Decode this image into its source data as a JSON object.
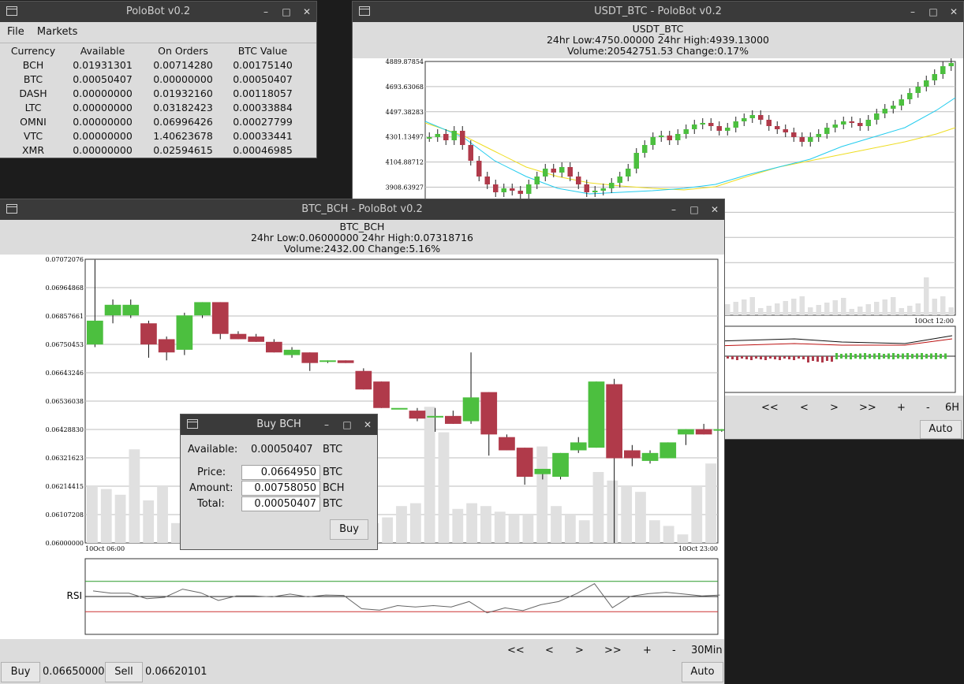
{
  "main_window": {
    "title": "PoloBot v0.2",
    "menu": [
      "File",
      "Markets"
    ],
    "balances": {
      "headers": [
        "Currency",
        "Available",
        "On Orders",
        "BTC Value"
      ],
      "rows": [
        [
          "BCH",
          "0.01931301",
          "0.00714280",
          "0.00175140"
        ],
        [
          "BTC",
          "0.00050407",
          "0.00000000",
          "0.00050407"
        ],
        [
          "DASH",
          "0.00000000",
          "0.01932160",
          "0.00118057"
        ],
        [
          "LTC",
          "0.00000000",
          "0.03182423",
          "0.00033884"
        ],
        [
          "OMNI",
          "0.00000000",
          "0.06996426",
          "0.00027799"
        ],
        [
          "VTC",
          "0.00000000",
          "1.40623678",
          "0.00033441"
        ],
        [
          "XMR",
          "0.00000000",
          "0.02594615",
          "0.00046985"
        ]
      ]
    }
  },
  "usdt_window": {
    "title": "USDT_BTC - PoloBot v0.2",
    "pair": "USDT_BTC",
    "stats_line1": "24hr Low:4750.00000  24hr High:4939.13000",
    "stats_line2": "Volume:20542751.53  Change:0.17%",
    "y_ticks": [
      "4889.87854",
      "4693.63068",
      "4497.38283",
      "4301.13497",
      "4104.88712",
      "3908.63927"
    ],
    "x_label": "10Oct 12:00",
    "nav": [
      "<<",
      "<",
      ">",
      ">>",
      "+",
      "-",
      "6H"
    ],
    "auto_label": "Auto"
  },
  "bch_window": {
    "title": "BTC_BCH - PoloBot v0.2",
    "pair": "BTC_BCH",
    "stats_line1": "24hr Low:0.06000000  24hr High:0.07318716",
    "stats_line2": "Volume:2432.00  Change:5.16%",
    "x_labels": [
      "10Oct 06:00",
      "10Oct 23:00"
    ],
    "rsi_label": "RSI",
    "nav": [
      "<<",
      "<",
      ">",
      ">>",
      "+",
      "-",
      "30Min"
    ],
    "buy_label": "Buy",
    "buy_price": "0.06650000",
    "sell_label": "Sell",
    "sell_price": "0.06620101",
    "auto_label": "Auto"
  },
  "buy_dialog": {
    "title": "Buy BCH",
    "available_label": "Available:",
    "available_value": "0.00050407",
    "available_unit": "BTC",
    "price_label": "Price:",
    "price_value": "0.0664950",
    "price_unit": "BTC",
    "amount_label": "Amount:",
    "amount_value": "0.00758050",
    "amount_unit": "BCH",
    "total_label": "Total:",
    "total_value": "0.00050407",
    "total_unit": "BTC",
    "buy_button": "Buy"
  },
  "colors": {
    "up": "#4cbf3f",
    "down": "#b03a4a",
    "volume": "#e0e0e0",
    "ma_fast": "#22ccee",
    "ma_slow": "#eedd22"
  },
  "chart_data": [
    {
      "type": "candlestick",
      "pair": "BTC_BCH",
      "interval": "30Min",
      "ylim": [
        0.06,
        0.07072076
      ],
      "y_ticks": [
        "0.07072076",
        "0.06964868",
        "0.06857661",
        "0.06750453",
        "0.06643246",
        "0.06536038",
        "0.06428830",
        "0.06321623",
        "0.06214415",
        "0.06107208",
        "0.06000000"
      ],
      "candles": [
        [
          0.0675,
          0.0684,
          0.0674,
          0.0707
        ],
        [
          0.0686,
          0.069,
          0.0683,
          0.0692
        ],
        [
          0.0686,
          0.069,
          0.0685,
          0.0692
        ],
        [
          0.0683,
          0.0675,
          0.067,
          0.0684
        ],
        [
          0.0677,
          0.0672,
          0.0669,
          0.0678
        ],
        [
          0.0673,
          0.0686,
          0.0671,
          0.0687
        ],
        [
          0.0686,
          0.0691,
          0.0685,
          0.0691
        ],
        [
          0.0691,
          0.0679,
          0.0677,
          0.0691
        ],
        [
          0.0679,
          0.0677,
          0.0677,
          0.068
        ],
        [
          0.0678,
          0.0676,
          0.0676,
          0.0679
        ],
        [
          0.0676,
          0.0672,
          0.0672,
          0.0677
        ],
        [
          0.0671,
          0.0673,
          0.067,
          0.0674
        ],
        [
          0.0672,
          0.0668,
          0.0665,
          0.0672
        ],
        [
          0.0669,
          0.0669,
          0.0668,
          0.0669
        ],
        [
          0.0669,
          0.0668,
          0.0668,
          0.0669
        ],
        [
          0.0665,
          0.0658,
          0.0658,
          0.0666
        ],
        [
          0.0661,
          0.0651,
          0.0651,
          0.0661
        ],
        [
          0.0651,
          0.0651,
          0.0651,
          0.0651
        ],
        [
          0.065,
          0.0647,
          0.0646,
          0.0651
        ],
        [
          0.0648,
          0.0648,
          0.0642,
          0.0651
        ],
        [
          0.0648,
          0.0645,
          0.0645,
          0.065
        ],
        [
          0.0646,
          0.0655,
          0.0645,
          0.0672
        ],
        [
          0.0657,
          0.0641,
          0.0633,
          0.0657
        ],
        [
          0.064,
          0.0635,
          0.0635,
          0.0641
        ],
        [
          0.0636,
          0.0625,
          0.0622,
          0.0636
        ],
        [
          0.0626,
          0.0628,
          0.0624,
          0.0628
        ],
        [
          0.0625,
          0.0634,
          0.0624,
          0.0634
        ],
        [
          0.0635,
          0.0638,
          0.0634,
          0.064
        ],
        [
          0.0636,
          0.0661,
          0.0636,
          0.0661
        ],
        [
          0.066,
          0.0632,
          0.06,
          0.0662
        ],
        [
          0.0635,
          0.0632,
          0.0629,
          0.0637
        ],
        [
          0.0631,
          0.0634,
          0.063,
          0.0635
        ],
        [
          0.0632,
          0.0638,
          0.0632,
          0.0638
        ],
        [
          0.0641,
          0.0643,
          0.0637,
          0.0643
        ],
        [
          0.0643,
          0.0641,
          0.0641,
          0.0645
        ],
        [
          0.0643,
          0.0643,
          0.0642,
          0.0643
        ]
      ],
      "volumes": [
        20,
        19,
        17,
        33,
        15,
        20,
        7,
        18,
        13,
        9,
        10,
        9,
        11,
        10,
        10,
        9,
        11,
        12,
        14,
        9,
        7,
        9,
        13,
        14,
        48,
        39,
        12,
        14,
        13,
        11,
        10,
        10,
        34,
        13,
        10,
        8,
        25,
        22,
        20,
        18,
        8,
        6,
        3,
        20,
        28
      ],
      "rsi_levels": [
        70,
        30
      ]
    },
    {
      "type": "candlestick",
      "pair": "USDT_BTC",
      "interval": "6H",
      "y_ticks": [
        "4889.87854",
        "4693.63068",
        "4497.38283",
        "4301.13497",
        "4104.88712",
        "3908.63927"
      ]
    }
  ]
}
